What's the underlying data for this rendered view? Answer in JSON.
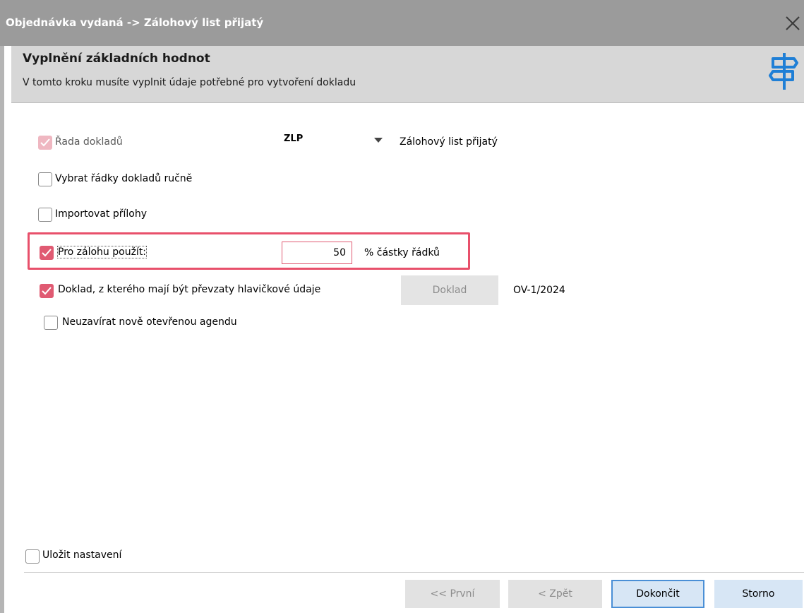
{
  "window": {
    "title": "Objednávka vydaná -> Zálohový list přijatý",
    "close_icon": "close-icon"
  },
  "header": {
    "title": "Vyplnění základních hodnot",
    "subtitle": "V tomto kroku musíte vyplnit údaje potřebné pro vytvoření dokladu",
    "icon": "signpost-icon"
  },
  "form": {
    "rada_dokladu": {
      "label": "Řada dokladů",
      "checked": true,
      "disabled": true,
      "select_value": "ZLP",
      "description": "Zálohový list přijatý"
    },
    "vybrat_radky": {
      "label": "Vybrat řádky dokladů ručně",
      "checked": false
    },
    "importovat_prilohy": {
      "label": "Importovat přílohy",
      "checked": false
    },
    "pro_zalohu": {
      "label": "Pro zálohu použít:",
      "checked": true,
      "value": "50",
      "unit": "% částky řádků"
    },
    "doklad_hlavicka": {
      "label": "Doklad, z kterého mají být převzaty hlavičkové údaje",
      "checked": true,
      "button_label": "Doklad",
      "value": "OV-1/2024"
    },
    "neuzavirat": {
      "label": "Neuzavírat nově otevřenou agendu",
      "checked": false
    }
  },
  "footer": {
    "save_settings": {
      "label": "Uložit nastavení",
      "checked": false
    },
    "buttons": {
      "first": "<< První",
      "back": "< Zpět",
      "finish": "Dokončit",
      "cancel": "Storno"
    }
  },
  "colors": {
    "accent": "#e05a72",
    "highlight_border": "#e8506b",
    "primary_button_border": "#4a8fd6",
    "titlebar": "#9b9b9b"
  }
}
